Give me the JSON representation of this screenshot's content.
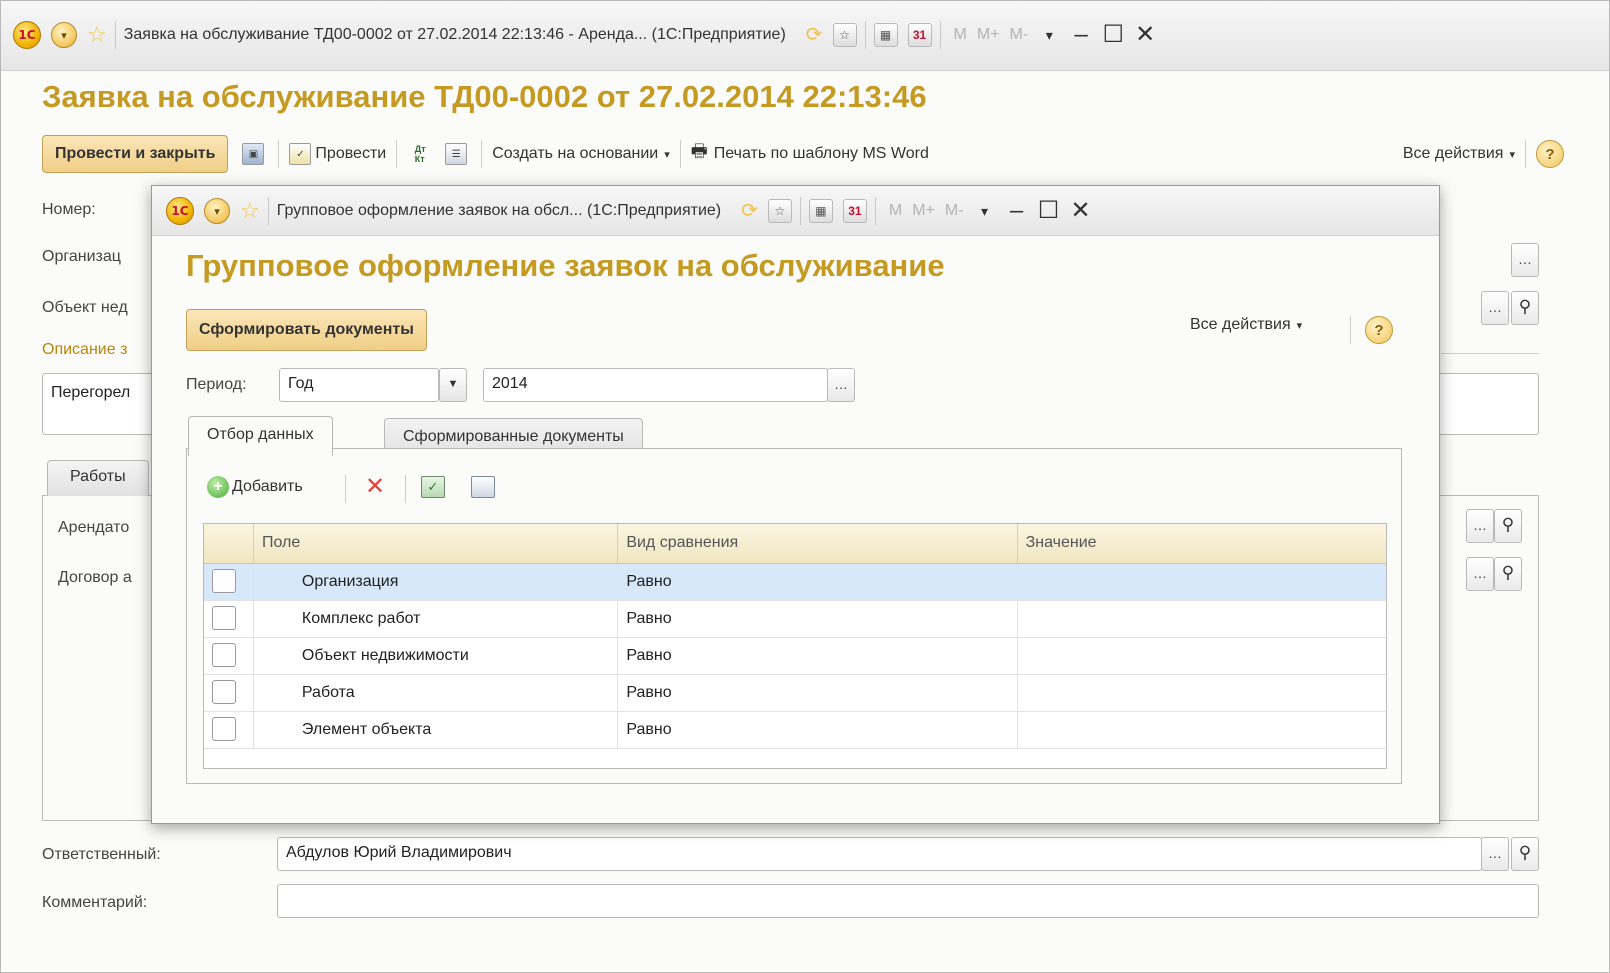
{
  "main_window": {
    "title": "Заявка на обслуживание ТД00-0002 от 27.02.2014 22:13:46 - Аренда... (1С:Предприятие)",
    "logo": "1С",
    "heading": "Заявка на обслуживание ТД00-0002 от 27.02.2014 22:13:46",
    "toolbar": {
      "post_close": "Провести и закрыть",
      "post": "Провести",
      "dt_kt": "Дт Кт",
      "create_based": "Создать на основании",
      "print_word": "Печать по шаблону MS Word",
      "all_actions": "Все действия",
      "help": "?"
    },
    "labels": {
      "number": "Номер:",
      "organization": "Организац",
      "object": "Объект нед",
      "description": "Описание з",
      "tenant": "Арендато",
      "contract": "Договор а",
      "responsible": "Ответственный:",
      "comment": "Комментарий:"
    },
    "description_value": "Перегорел",
    "tab_works": "Работы",
    "responsible_value": "Абдулов Юрий Владимирович",
    "comment_value": "",
    "memory_buttons": [
      "M",
      "M+",
      "M-"
    ]
  },
  "dialog": {
    "title": "Групповое оформление заявок на обсл... (1С:Предприятие)",
    "heading": "Групповое оформление заявок на обслуживание",
    "generate_button": "Сформировать документы",
    "all_actions": "Все действия",
    "help": "?",
    "period_label": "Период:",
    "period_type": "Год",
    "period_value": "2014",
    "tabs": [
      "Отбор данных",
      "Сформированные документы"
    ],
    "add_button": "Добавить",
    "columns": [
      "Поле",
      "Вид сравнения",
      "Значение"
    ],
    "rows": [
      {
        "field": "Организация",
        "comparison": "Равно",
        "value": "",
        "checked": false
      },
      {
        "field": "Комплекс работ",
        "comparison": "Равно",
        "value": "",
        "checked": false
      },
      {
        "field": "Объект недвижимости",
        "comparison": "Равно",
        "value": "",
        "checked": false
      },
      {
        "field": "Работа",
        "comparison": "Равно",
        "value": "",
        "checked": false
      },
      {
        "field": "Элемент объекта",
        "comparison": "Равно",
        "value": "",
        "checked": false
      }
    ],
    "selected_row": 0
  },
  "icons": [
    "logo-icon",
    "dropdown-menu-icon",
    "favorite-star-icon",
    "history-icon",
    "bookmark-icon",
    "calculator-icon",
    "calendar-icon",
    "minimize-icon",
    "maximize-icon",
    "close-icon",
    "save-icon",
    "post-icon",
    "dt-kt-icon",
    "report-icon",
    "print-icon",
    "help-icon",
    "ellipsis-icon",
    "search-icon",
    "add-icon",
    "delete-icon",
    "check-all-icon",
    "uncheck-all-icon"
  ],
  "colors": {
    "accent_heading": "#c49a23",
    "button_gold": "#f0cf86",
    "selected_row": "#d6e8f9",
    "delete_red": "#e0453a"
  }
}
